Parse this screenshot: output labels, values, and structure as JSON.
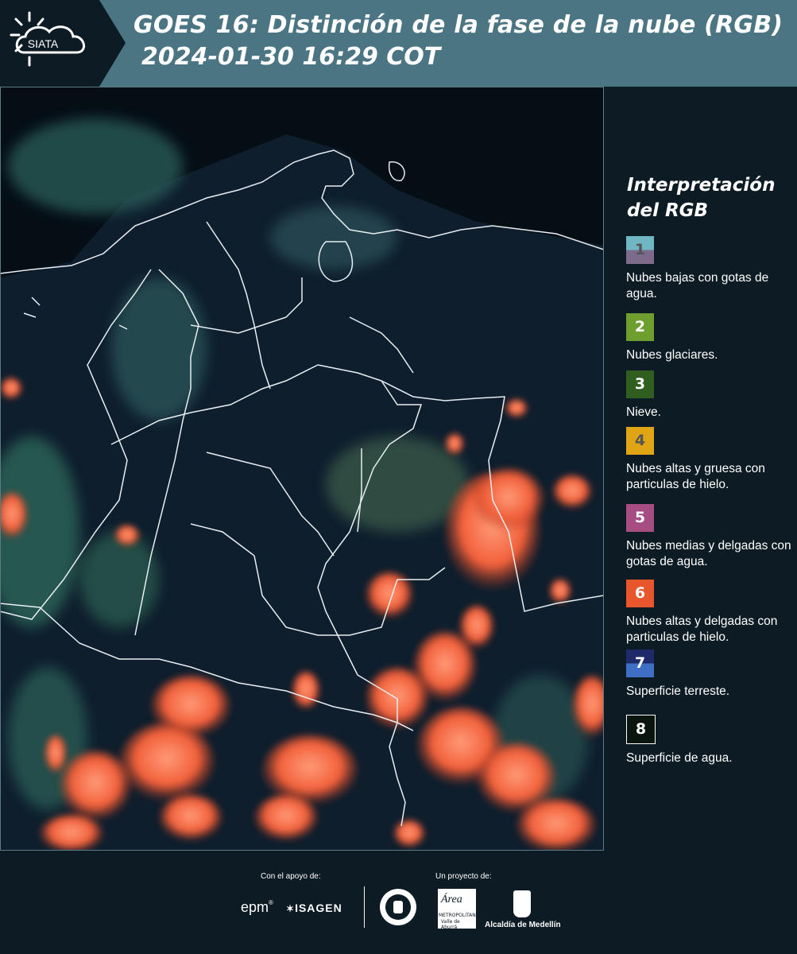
{
  "header": {
    "logo_text": "SIATA",
    "title_line1": "GOES 16: Distinción de la fase de la nube (RGB)",
    "title_line2": "2024-01-30 16:29 COT"
  },
  "legend": {
    "title_line1": "Interpretación",
    "title_line2": "del RGB",
    "items": [
      {
        "num": "1",
        "label": "Nubes bajas con gotas de agua.",
        "color_top": "#6fb7c2",
        "color_bottom": "#7d6b8c",
        "num_color": "#555555"
      },
      {
        "num": "2",
        "label": "Nubes glaciares.",
        "color_top": "#6e9e2e",
        "color_bottom": "#6e9e2e",
        "num_color": "#ffffff"
      },
      {
        "num": "3",
        "label": "Nieve.",
        "color_top": "#2f5e1e",
        "color_bottom": "#2f5e1e",
        "num_color": "#ffffff"
      },
      {
        "num": "4",
        "label": "Nubes altas y gruesa con particulas de hielo.",
        "color_top": "#e0a514",
        "color_bottom": "#e0a514",
        "num_color": "#555555"
      },
      {
        "num": "5",
        "label": "Nubes medias y delgadas con gotas de agua.",
        "color_top": "#a64d83",
        "color_bottom": "#a64d83",
        "num_color": "#ffffff"
      },
      {
        "num": "6",
        "label": "Nubes altas y delgadas con particulas de hielo.",
        "color_top": "#e7562c",
        "color_bottom": "#e7562c",
        "num_color": "#ffffff"
      },
      {
        "num": "7",
        "label": "Superficie terreste.",
        "color_top": "#1f2a6b",
        "color_bottom": "#3f6fc4",
        "num_color": "#ffffff"
      },
      {
        "num": "8",
        "label": "Superficie de agua.",
        "color_top": "#0a1510",
        "color_bottom": "#0a1510",
        "num_color": "#ffffff"
      }
    ]
  },
  "footer": {
    "support_label": "Con el apoyo de:",
    "project_label": "Un proyecto de:",
    "epm_label": "epm",
    "isagen_label": "ISAGEN",
    "area_label": "Área",
    "area_sub": "METROPOLITANA",
    "area_sub2": "Valle de Aburrá",
    "alcaldia_label": "Alcaldía de Medellín"
  }
}
